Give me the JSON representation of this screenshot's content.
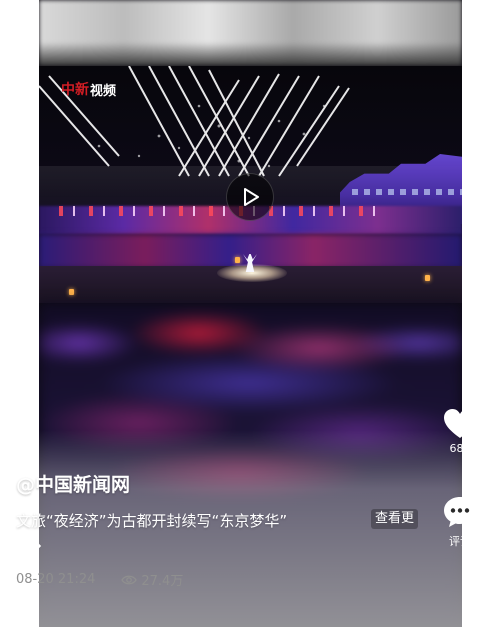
{
  "logo": {
    "mark": "中新",
    "text": "视频"
  },
  "video": {
    "play_label": ""
  },
  "post": {
    "author": "@中国新闻网",
    "description": "文旅“夜经济”为古都开封续写“东京梦华”",
    "more_label": "查看更",
    "more_label_2": "多",
    "date": "08-20 21:24",
    "views": "27.4万"
  },
  "actions": {
    "like_count": "685",
    "comment_label": "评论"
  },
  "colors": {
    "brand_red": "#d21d24",
    "meta_gray": "#8f8f8f"
  },
  "icons": [
    "heart-icon",
    "comment-icon",
    "play-icon",
    "eye-icon",
    "chevron-right-icon"
  ]
}
